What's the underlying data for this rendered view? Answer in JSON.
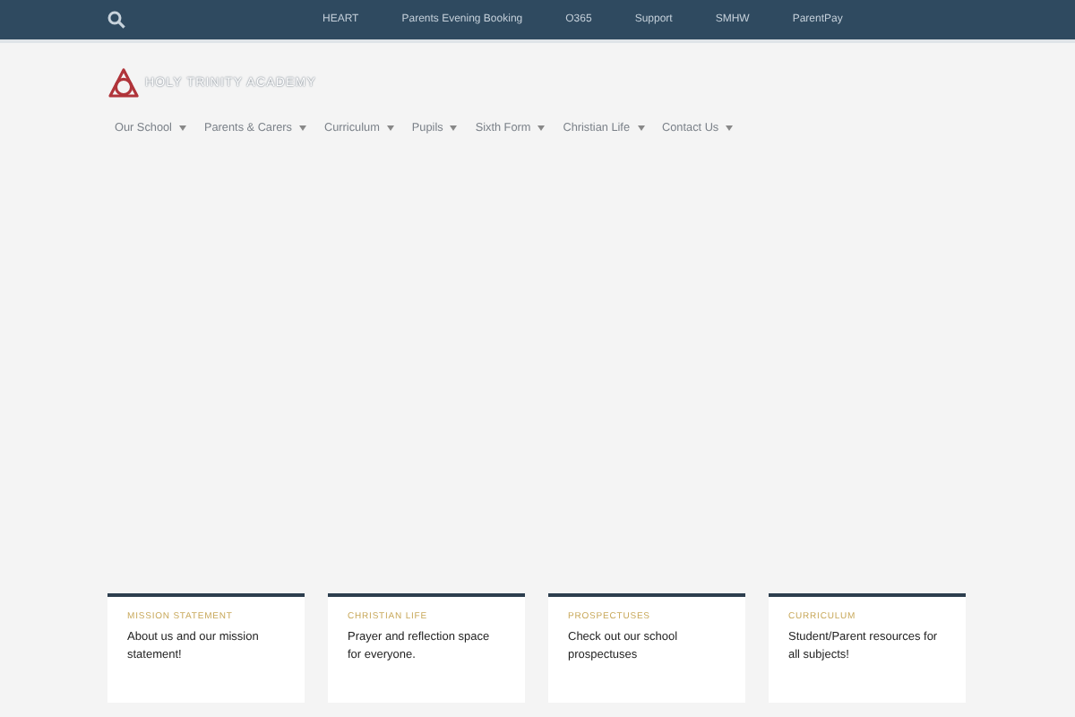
{
  "top_bar": {
    "links": [
      "HEART",
      "Parents Evening Booking",
      "O365",
      "Support",
      "SMHW",
      "ParentPay"
    ]
  },
  "logo": {
    "text": "HOLY TRINITY ACADEMY"
  },
  "main_nav": [
    {
      "label": "Our School"
    },
    {
      "label": "Parents & Carers"
    },
    {
      "label": "Curriculum"
    },
    {
      "label": "Pupils"
    },
    {
      "label": "Sixth Form"
    },
    {
      "label": "Christian Life"
    },
    {
      "label": "Contact Us"
    }
  ],
  "cards": [
    {
      "category": "MISSION STATEMENT",
      "text": "About us and our mission statement!"
    },
    {
      "category": "CHRISTIAN LIFE",
      "text": "Prayer and reflection space for everyone."
    },
    {
      "category": "PROSPECTUSES",
      "text": "Check out our school prospectuses"
    },
    {
      "category": "CURRICULUM",
      "text": "Student/Parent resources for all subjects!"
    }
  ]
}
